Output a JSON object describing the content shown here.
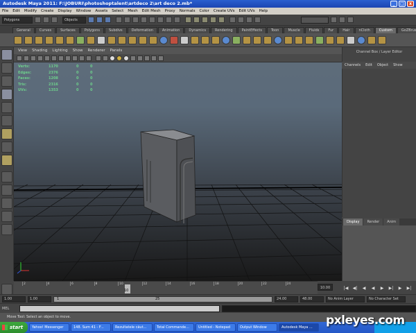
{
  "window": {
    "title": "Autodesk Maya 2011: F:\\JOBURI\\photoshoptalent\\artdeco 2\\art deco 2.mb*",
    "min": "_",
    "max": "□",
    "close": "x"
  },
  "menubar": [
    "File",
    "Edit",
    "Modify",
    "Create",
    "Display",
    "Window",
    "Assets",
    "Select",
    "Mesh",
    "Edit Mesh",
    "Proxy",
    "Normals",
    "Color",
    "Create UVs",
    "Edit UVs",
    "Help"
  ],
  "statusline": {
    "menuset": "Polygons",
    "selection_mode": "Objects"
  },
  "shelf": {
    "tabs": [
      "General",
      "Curves",
      "Surfaces",
      "Polygons",
      "Subdivs",
      "Deformation",
      "Animation",
      "Dynamics",
      "Rendering",
      "PaintEffects",
      "Toon",
      "Muscle",
      "Fluids",
      "Fur",
      "Hair",
      "nCloth",
      "Custom",
      "GoZBrush"
    ],
    "active": "Custom"
  },
  "viewport": {
    "menu": [
      "View",
      "Shading",
      "Lighting",
      "Show",
      "Renderer",
      "Panels"
    ],
    "hud": [
      {
        "label": "Verts:",
        "v1": "1170",
        "v2": "0",
        "v3": "0"
      },
      {
        "label": "Edges:",
        "v1": "2376",
        "v2": "0",
        "v3": "0"
      },
      {
        "label": "Faces:",
        "v1": "1208",
        "v2": "0",
        "v3": "0"
      },
      {
        "label": "Tris:",
        "v1": "2316",
        "v2": "0",
        "v3": "0"
      },
      {
        "label": "UVs:",
        "v1": "1353",
        "v2": "0",
        "v3": "0"
      }
    ]
  },
  "channel_box": {
    "title": "Channel Box / Layer Editor",
    "menu": [
      "Channels",
      "Edit",
      "Object",
      "Show"
    ],
    "layer_tabs": [
      "Display",
      "Render",
      "Anim"
    ],
    "active_layer_tab": "Display"
  },
  "time_slider": {
    "ticks": [
      "2",
      "4",
      "6",
      "8",
      "10",
      "12",
      "14",
      "16",
      "18",
      "20",
      "22",
      "24"
    ],
    "current_frame_label": "10",
    "current_frame_field": "10.00"
  },
  "range_slider": {
    "start": "1.00",
    "start2": "1.00",
    "range_start": "1",
    "range_end": "25",
    "end": "24.00",
    "end2": "48.00",
    "anim_layer": "No Anim Layer",
    "character": "No Character Set"
  },
  "command_line": {
    "label": "MEL"
  },
  "help_line": "Move Tool: Select an object to move.",
  "taskbar": {
    "start": "start",
    "tasks": [
      "Yahoo! Messenger",
      "148. Sum 41 - F...",
      "Rezultatele căut...",
      "Total Commande...",
      "Untitled - Notepad",
      "Output Window",
      "Autodesk Maya ..."
    ],
    "active_task": "Autodesk Maya ..."
  },
  "watermark": "pxleyes.com"
}
